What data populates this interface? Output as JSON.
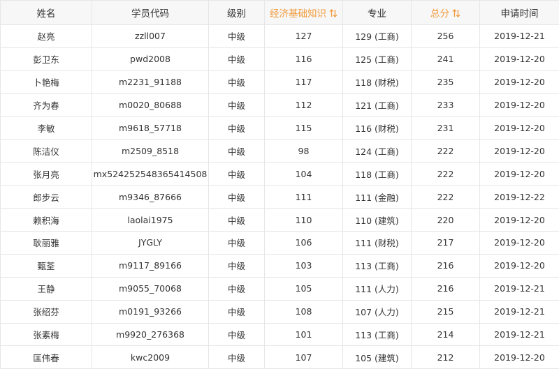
{
  "columns": [
    {
      "key": "name",
      "label": "姓名",
      "accent": false,
      "sortable": false
    },
    {
      "key": "student_code",
      "label": "学员代码",
      "accent": false,
      "sortable": false
    },
    {
      "key": "level",
      "label": "级别",
      "accent": false,
      "sortable": false
    },
    {
      "key": "econ_score",
      "label": "经济基础知识",
      "accent": true,
      "sortable": true
    },
    {
      "key": "major_score",
      "label": "专业",
      "accent": false,
      "sortable": false
    },
    {
      "key": "total",
      "label": "总分",
      "accent": true,
      "sortable": true
    },
    {
      "key": "apply_date",
      "label": "申请时间",
      "accent": false,
      "sortable": false
    }
  ],
  "sort_icon": "sort-up-down-icon",
  "accent_color": "#f29a3a",
  "rows": [
    {
      "name": "赵亮",
      "student_code": "zzll007",
      "level": "中级",
      "econ_score": "127",
      "major_score": "129 (工商)",
      "total": "256",
      "apply_date": "2019-12-21"
    },
    {
      "name": "彭卫东",
      "student_code": "pwd2008",
      "level": "中级",
      "econ_score": "116",
      "major_score": "125 (工商)",
      "total": "241",
      "apply_date": "2019-12-20"
    },
    {
      "name": "卜艳梅",
      "student_code": "m2231_91188",
      "level": "中级",
      "econ_score": "117",
      "major_score": "118 (财税)",
      "total": "235",
      "apply_date": "2019-12-20"
    },
    {
      "name": "齐为春",
      "student_code": "m0020_80688",
      "level": "中级",
      "econ_score": "112",
      "major_score": "121 (工商)",
      "total": "233",
      "apply_date": "2019-12-20"
    },
    {
      "name": "李敏",
      "student_code": "m9618_57718",
      "level": "中级",
      "econ_score": "115",
      "major_score": "116 (财税)",
      "total": "231",
      "apply_date": "2019-12-20"
    },
    {
      "name": "陈洁仪",
      "student_code": "m2509_8518",
      "level": "中级",
      "econ_score": "98",
      "major_score": "124 (工商)",
      "total": "222",
      "apply_date": "2019-12-20"
    },
    {
      "name": "张月亮",
      "student_code": "mx524252548365414508",
      "level": "中级",
      "econ_score": "104",
      "major_score": "118 (工商)",
      "total": "222",
      "apply_date": "2019-12-20"
    },
    {
      "name": "郎步云",
      "student_code": "m9346_87666",
      "level": "中级",
      "econ_score": "111",
      "major_score": "111 (金融)",
      "total": "222",
      "apply_date": "2019-12-22"
    },
    {
      "name": "赖积海",
      "student_code": "laolai1975",
      "level": "中级",
      "econ_score": "110",
      "major_score": "110 (建筑)",
      "total": "220",
      "apply_date": "2019-12-20"
    },
    {
      "name": "耿丽雅",
      "student_code": "JYGLY",
      "level": "中级",
      "econ_score": "106",
      "major_score": "111 (财税)",
      "total": "217",
      "apply_date": "2019-12-20"
    },
    {
      "name": "甄荃",
      "student_code": "m9117_89166",
      "level": "中级",
      "econ_score": "103",
      "major_score": "113 (工商)",
      "total": "216",
      "apply_date": "2019-12-20"
    },
    {
      "name": "王静",
      "student_code": "m9055_70068",
      "level": "中级",
      "econ_score": "105",
      "major_score": "111 (人力)",
      "total": "216",
      "apply_date": "2019-12-21"
    },
    {
      "name": "张绍芬",
      "student_code": "m0191_93266",
      "level": "中级",
      "econ_score": "108",
      "major_score": "107 (人力)",
      "total": "215",
      "apply_date": "2019-12-21"
    },
    {
      "name": "张素梅",
      "student_code": "m9920_276368",
      "level": "中级",
      "econ_score": "101",
      "major_score": "113 (工商)",
      "total": "214",
      "apply_date": "2019-12-21"
    },
    {
      "name": "匡伟春",
      "student_code": "kwc2009",
      "level": "中级",
      "econ_score": "107",
      "major_score": "105 (建筑)",
      "total": "212",
      "apply_date": "2019-12-20"
    }
  ]
}
